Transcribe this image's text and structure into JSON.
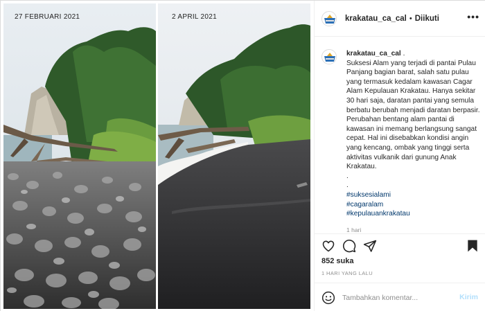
{
  "photos": [
    {
      "date": "27 FEBRUARI 2021",
      "scene": "rocky-beach"
    },
    {
      "date": "2 APRIL 2021",
      "scene": "sandy-beach"
    }
  ],
  "header": {
    "username": "krakatau_ca_cal",
    "separator": "•",
    "follow_label": "Diikuti",
    "more_icon": "more-horizontal-icon"
  },
  "caption": {
    "username": "krakatau_ca_cal",
    "text": "Suksesi Alam yang terjadi di pantai Pulau Panjang bagian barat, salah satu pulau yang termasuk kedalam kawasan Cagar Alam Kepulauan Krakatau. Hanya sekitar 30 hari saja, daratan pantai yang semula berbatu berubah menjadi daratan berpasir. Perubahan bentang alam pantai di kawasan ini memang berlangsung sangat cepat. Hal ini disebabkan kondisi angin yang kencang, ombak yang tinggi serta aktivitas vulkanik dari gunung Anak Krakatau.",
    "dot1": ".",
    "dot2": ".",
    "hashtags": [
      "#suksesialami",
      "#cagaralam",
      "#kepulauankrakatau"
    ],
    "time_ago": "1 hari"
  },
  "actions": {
    "like_icon": "heart-icon",
    "comment_icon": "comment-icon",
    "share_icon": "send-icon",
    "save_icon": "bookmark-icon"
  },
  "likes": "852 suka",
  "posted": "1 HARI YANG LALU",
  "comment": {
    "emoji_icon": "smiley-icon",
    "placeholder": "Tambahkan komentar...",
    "send_label": "Kirim"
  },
  "colors": {
    "accent_link": "#00376b",
    "send_disabled": "#b2dffc",
    "muted": "#8e8e8e",
    "border": "#dbdbdb"
  }
}
